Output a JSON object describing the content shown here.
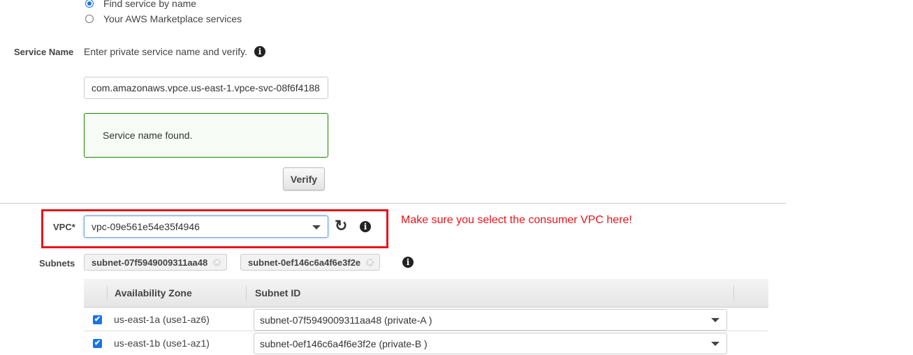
{
  "service_type": {
    "options": [
      {
        "label": "Find service by name",
        "checked": true
      },
      {
        "label": "Your AWS Marketplace services",
        "checked": false
      }
    ]
  },
  "service_name": {
    "label": "Service Name",
    "hint": "Enter private service name and verify.",
    "value": "com.amazonaws.vpce.us-east-1.vpce-svc-08f6f4188",
    "status_message": "Service name found.",
    "verify_label": "Verify"
  },
  "vpc": {
    "label": "VPC*",
    "selected": "vpc-09e561e54e35f4946",
    "annotation": "Make sure you select the consumer VPC here!"
  },
  "subnets": {
    "label": "Subnets",
    "chips": [
      "subnet-07f5949009311aa48",
      "subnet-0ef146c6a4f6e3f2e"
    ],
    "table": {
      "columns": [
        "Availability Zone",
        "Subnet ID"
      ],
      "rows": [
        {
          "checked": true,
          "az": "us-east-1a (use1-az6)",
          "subnet": "subnet-07f5949009311aa48 (private-A )"
        },
        {
          "checked": true,
          "az": "us-east-1b (use1-az1)",
          "subnet": "subnet-0ef146c6a4f6e3f2e (private-B )"
        }
      ]
    }
  },
  "colors": {
    "accent": "#1a73e8",
    "annotation_red": "#e8141c",
    "success_border": "#1d8102"
  }
}
